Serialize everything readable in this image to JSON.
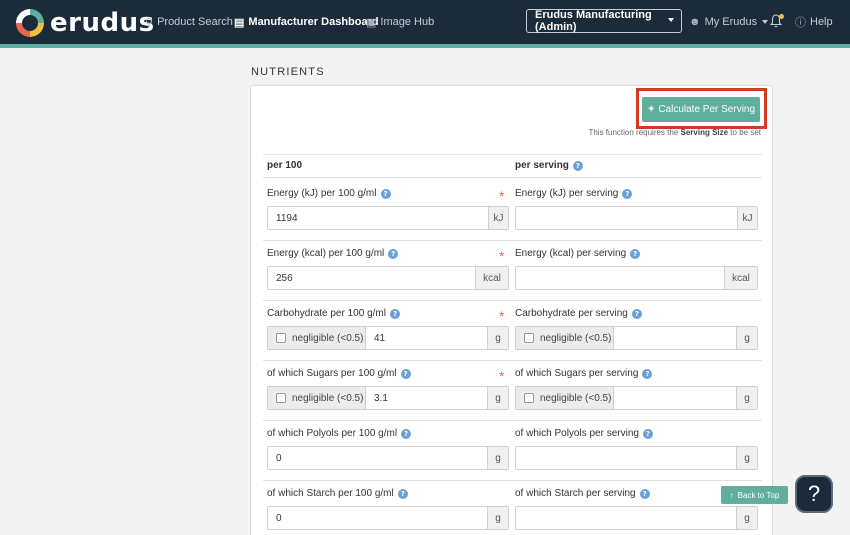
{
  "header": {
    "brand": "erudus",
    "nav": [
      {
        "label": "Product Search",
        "icon": "search-icon"
      },
      {
        "label": "Manufacturer Dashboard",
        "icon": "chart-icon"
      },
      {
        "label": "Image Hub",
        "icon": "camera-icon"
      }
    ],
    "org_select": "Erudus Manufacturing (Admin)",
    "my_account": "My Erudus",
    "help": "Help"
  },
  "section_title": "NUTRIENTS",
  "calc": {
    "button": "Calculate Per Serving",
    "note_prefix": "This function requires the ",
    "note_bold": "Serving Size",
    "note_suffix": " to be set"
  },
  "columns": {
    "per100": "per 100",
    "per_serving": "per serving"
  },
  "negligible_label": "negligible (<0.5)",
  "rows": [
    {
      "label100": "Energy (kJ) per 100 g/ml",
      "labelServ": "Energy (kJ) per serving",
      "value": "1194",
      "unit": "kJ"
    },
    {
      "label100": "Energy (kcal) per 100 g/ml",
      "labelServ": "Energy (kcal) per serving",
      "value": "256",
      "unit": "kcal"
    },
    {
      "label100": "Carbohydrate per 100 g/ml",
      "labelServ": "Carbohydrate per serving",
      "value": "41",
      "unit": "g"
    },
    {
      "label100": "of which Sugars per 100 g/ml",
      "labelServ": "of which Sugars per serving",
      "value": "3.1",
      "unit": "g"
    },
    {
      "label100": "of which Polyols per 100 g/ml",
      "labelServ": "of which Polyols per serving",
      "value": "0",
      "unit": "g"
    },
    {
      "label100": "of which Starch per 100 g/ml",
      "labelServ": "of which Starch per serving",
      "value": "0",
      "unit": "g"
    }
  ],
  "back_to_top": "Back to Top",
  "help_bubble": "?",
  "required_mark": "*",
  "colors": {
    "header": "#1c2b3a",
    "accent": "#5fae9e",
    "highlight": "#d33b21",
    "required": "#e36a4f"
  }
}
